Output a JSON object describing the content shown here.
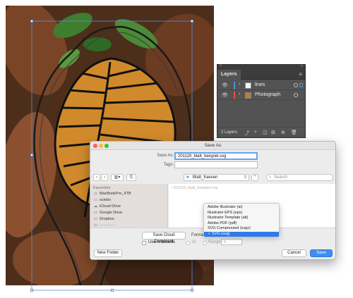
{
  "colors": {
    "accent": "#3d8ef0",
    "layer_lines": "#4a90d9",
    "layer_photograph": "#e0533f",
    "panel_bg": "#535353"
  },
  "layers_panel": {
    "title": "Layers",
    "layers": [
      {
        "name": "lines",
        "visible": true,
        "selected": true
      },
      {
        "name": "Photograph",
        "visible": true,
        "selected": false
      }
    ],
    "footer_count": "2 Layers"
  },
  "save_dialog": {
    "title": "Save As",
    "save_as_label": "Save As:",
    "save_as_value": "201119_blatt_beispiel.svg",
    "tags_label": "Tags:",
    "tags_value": "",
    "location": "Blatt_fraesen",
    "search_placeholder": "Search",
    "sidebar": {
      "header": "Favorites",
      "items": [
        "MacBookPro_4TB",
        "sciebo",
        "iCloud Drive",
        "Google Drive",
        "Dropbox",
        "————"
      ]
    },
    "files": [
      "201119_blatt_beispiel.svg"
    ],
    "save_cloud_label": "Save Cloud Document",
    "format_label": "Format",
    "format_value": "SVG (svg)",
    "use_artboards_label": "Use Artboards",
    "all_label": "All",
    "range_label": "Range:",
    "range_value": "1",
    "new_folder_label": "New Folder",
    "cancel_label": "Cancel",
    "save_label": "Save"
  },
  "format_menu": {
    "options": [
      "Adobe Illustrator (ai)",
      "Illustrator EPS (eps)",
      "Illustrator Template (ait)",
      "Adobe PDF (pdf)",
      "SVG Compressed (svgz)",
      "SVG (svg)"
    ],
    "selected": "SVG (svg)"
  }
}
